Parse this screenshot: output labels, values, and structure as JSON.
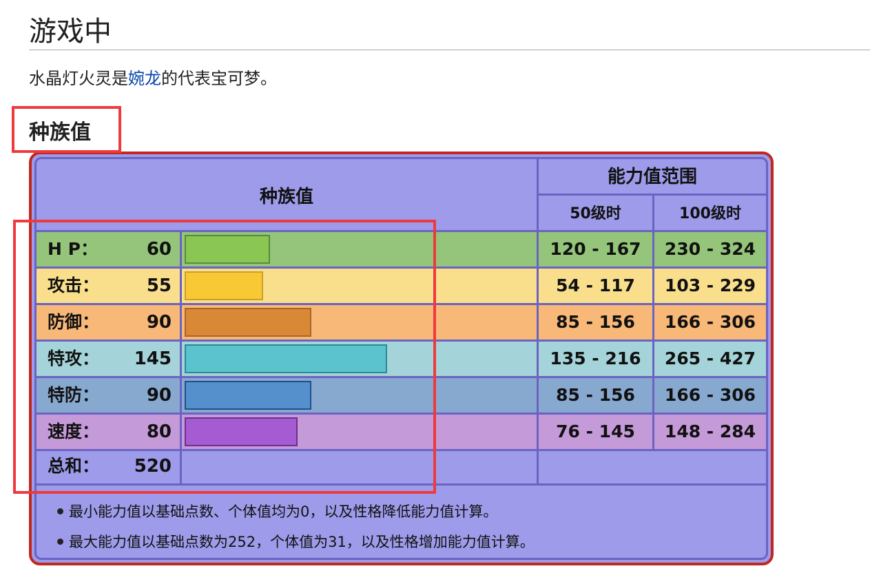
{
  "heading": "游戏中",
  "intro": {
    "before": "水晶灯火灵是",
    "link": "婉龙",
    "after": "的代表宝可梦。"
  },
  "subheading": "种族值",
  "table": {
    "header_main": "种族值",
    "header_range": "能力值范围",
    "header_lv50": "50级时",
    "header_lv100": "100级时",
    "rows": [
      {
        "label": "H P：",
        "value": "60",
        "lv50": "120 - 167",
        "lv100": "230 - 324",
        "bg": "#95c57a",
        "bar_fill": "#89c653",
        "bar_border": "#5a8a3a",
        "bar_value": 60
      },
      {
        "label": "攻击：",
        "value": "55",
        "lv50": "54 - 117",
        "lv100": "103 - 229",
        "bg": "#f9df8c",
        "bar_fill": "#f8c934",
        "bar_border": "#c8a02a",
        "bar_value": 55
      },
      {
        "label": "防御：",
        "value": "90",
        "lv50": "85 - 156",
        "lv100": "166 - 306",
        "bg": "#f8b877",
        "bar_fill": "#d98935",
        "bar_border": "#a9632a",
        "bar_value": 90
      },
      {
        "label": "特攻：",
        "value": "145",
        "lv50": "135 - 216",
        "lv100": "265 - 427",
        "bg": "#a4d4d9",
        "bar_fill": "#5ac3cd",
        "bar_border": "#2a8a93",
        "bar_value": 145
      },
      {
        "label": "特防：",
        "value": "90",
        "lv50": "85 - 156",
        "lv100": "166 - 306",
        "bg": "#88a9cf",
        "bar_fill": "#5590cc",
        "bar_border": "#1f4f8f",
        "bar_value": 90
      },
      {
        "label": "速度：",
        "value": "80",
        "lv50": "76 - 145",
        "lv100": "148 - 284",
        "bg": "#c59ad8",
        "bar_fill": "#a55bd1",
        "bar_border": "#6d2f8f",
        "bar_value": 80
      }
    ],
    "total_label": "总和：",
    "total_value": "520"
  },
  "notes": [
    "最小能力值以基础点数、个体值均为0，以及性格降低能力值计算。",
    "最大能力值以基础点数为252，个体值为31，以及性格增加能力值计算。"
  ],
  "colors": {
    "table_bg": "#9d9bea",
    "grid": "#6a63c2",
    "outer_border": "#c0271d",
    "highlight": "#ee3a3f",
    "link": "#0645ad"
  }
}
